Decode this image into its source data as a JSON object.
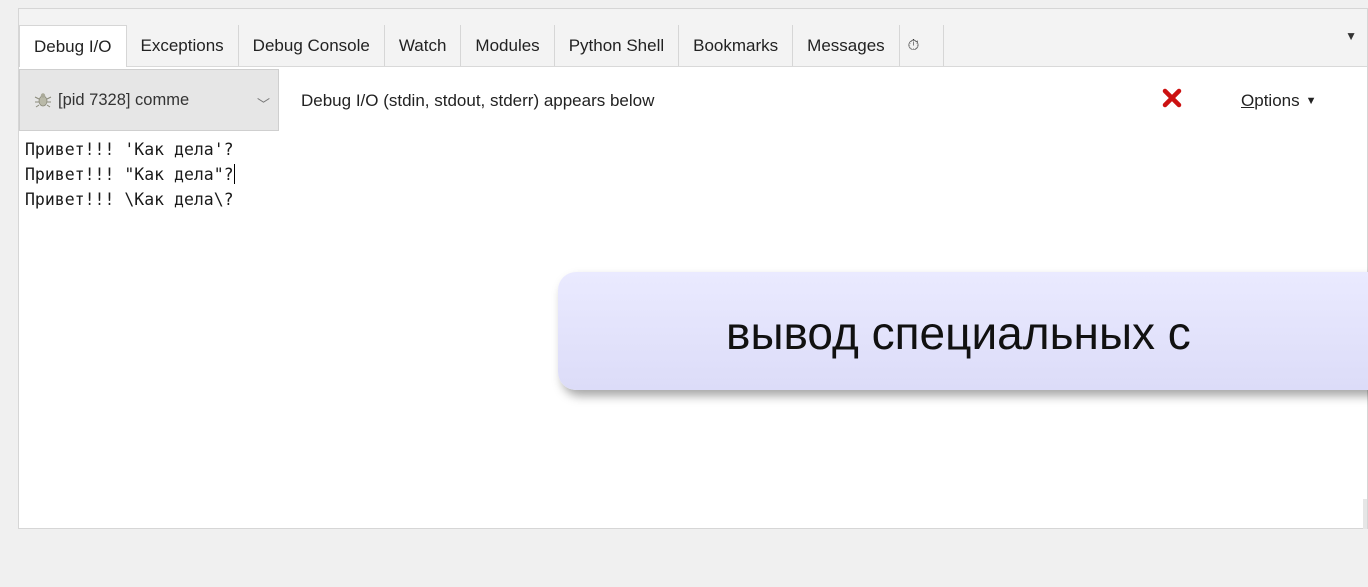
{
  "tabs": [
    {
      "label": "Debug I/O",
      "active": true
    },
    {
      "label": "Exceptions",
      "active": false
    },
    {
      "label": "Debug Console",
      "active": false
    },
    {
      "label": "Watch",
      "active": false
    },
    {
      "label": "Modules",
      "active": false
    },
    {
      "label": "Python Shell",
      "active": false
    },
    {
      "label": "Bookmarks",
      "active": false
    },
    {
      "label": "Messages",
      "active": false
    },
    {
      "label": "⏱",
      "active": false
    }
  ],
  "tab_menu_icon": "chevron-down-icon",
  "toolbar": {
    "process_select": "[pid 7328] comme",
    "io_label": "Debug I/O (stdin, stdout, stderr) appears below",
    "options_label_underlined": "O",
    "options_label_rest": "ptions",
    "close_icon_color": "#cc1111"
  },
  "console": {
    "lines": [
      "Привет!!! 'Как дела'?",
      "Привет!!! \"Как дела\"?",
      "Привет!!! \\Как дела\\?"
    ]
  },
  "callout": {
    "text": "вывод специальных с"
  }
}
